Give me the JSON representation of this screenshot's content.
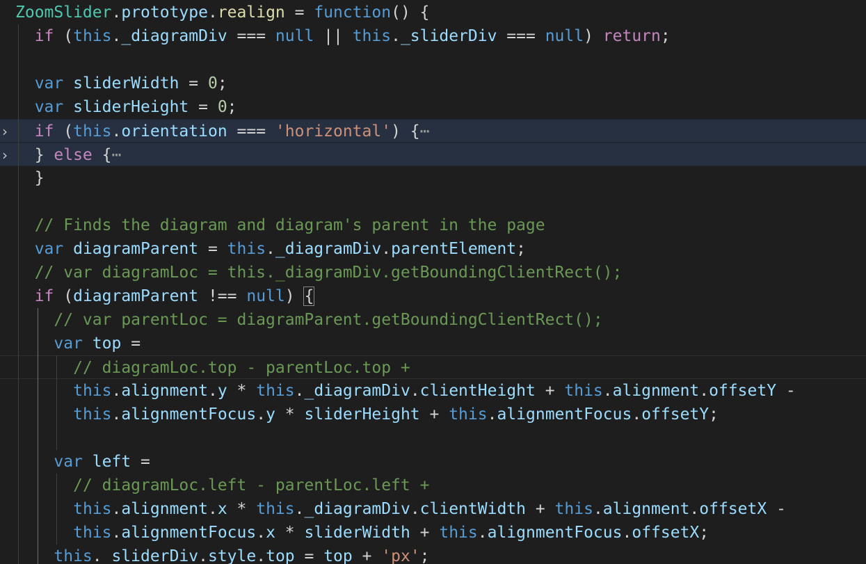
{
  "editor": {
    "language": "javascript",
    "theme_colors": {
      "background": "#1e1e1e",
      "keyword": "#569cd6",
      "control": "#c586c0",
      "function": "#dcdcaa",
      "class": "#4ec9b0",
      "variable": "#9cdcfe",
      "number": "#b5cea8",
      "string": "#ce9178",
      "comment": "#6a9955",
      "folded_line_bg": "#263040"
    },
    "folded_region_icon": "chevron-right-icon",
    "lines": [
      {
        "tokens": [
          [
            "cls",
            "ZoomSlider"
          ],
          [
            "op",
            "."
          ],
          [
            "var",
            "prototype"
          ],
          [
            "op",
            "."
          ],
          [
            "fn",
            "realign"
          ],
          [
            "op",
            " = "
          ],
          [
            "kw",
            "function"
          ],
          [
            "op",
            "() {"
          ]
        ]
      },
      {
        "tokens": [
          [
            "ctl",
            "if"
          ],
          [
            "op",
            " ("
          ],
          [
            "kw",
            "this"
          ],
          [
            "op",
            "."
          ],
          [
            "var",
            "_diagramDiv"
          ],
          [
            "op",
            " === "
          ],
          [
            "kw",
            "null"
          ],
          [
            "op",
            " || "
          ],
          [
            "kw",
            "this"
          ],
          [
            "op",
            "."
          ],
          [
            "var",
            "_sliderDiv"
          ],
          [
            "op",
            " === "
          ],
          [
            "kw",
            "null"
          ],
          [
            "op",
            ") "
          ],
          [
            "ctl",
            "return"
          ],
          [
            "op",
            ";"
          ]
        ]
      },
      {
        "tokens": []
      },
      {
        "tokens": [
          [
            "kw",
            "var"
          ],
          [
            "op",
            " "
          ],
          [
            "var",
            "sliderWidth"
          ],
          [
            "op",
            " = "
          ],
          [
            "num",
            "0"
          ],
          [
            "op",
            ";"
          ]
        ]
      },
      {
        "tokens": [
          [
            "kw",
            "var"
          ],
          [
            "op",
            " "
          ],
          [
            "var",
            "sliderHeight"
          ],
          [
            "op",
            " = "
          ],
          [
            "num",
            "0"
          ],
          [
            "op",
            ";"
          ]
        ]
      },
      {
        "tokens": [
          [
            "ctl",
            "if"
          ],
          [
            "op",
            " ("
          ],
          [
            "kw",
            "this"
          ],
          [
            "op",
            "."
          ],
          [
            "var",
            "orientation"
          ],
          [
            "op",
            " === "
          ],
          [
            "str",
            "'horizontal'"
          ],
          [
            "op",
            ") {"
          ],
          [
            "ellipsis",
            "⋯"
          ]
        ]
      },
      {
        "tokens": [
          [
            "op",
            "} "
          ],
          [
            "ctl",
            "else"
          ],
          [
            "op",
            " {"
          ],
          [
            "ellipsis",
            "⋯"
          ]
        ]
      },
      {
        "tokens": [
          [
            "op",
            "}"
          ]
        ]
      },
      {
        "tokens": []
      },
      {
        "tokens": [
          [
            "cmt",
            "// Finds the diagram and diagram's parent in the page"
          ]
        ]
      },
      {
        "tokens": [
          [
            "kw",
            "var"
          ],
          [
            "op",
            " "
          ],
          [
            "var",
            "diagramParent"
          ],
          [
            "op",
            " = "
          ],
          [
            "kw",
            "this"
          ],
          [
            "op",
            "."
          ],
          [
            "var",
            "_diagramDiv"
          ],
          [
            "op",
            "."
          ],
          [
            "var",
            "parentElement"
          ],
          [
            "op",
            ";"
          ]
        ]
      },
      {
        "tokens": [
          [
            "cmt",
            "// var diagramLoc = this._diagramDiv.getBoundingClientRect();"
          ]
        ]
      },
      {
        "tokens": [
          [
            "ctl",
            "if"
          ],
          [
            "op",
            " ("
          ],
          [
            "var",
            "diagramParent"
          ],
          [
            "op",
            " !== "
          ],
          [
            "kw",
            "null"
          ],
          [
            "op",
            ") "
          ],
          [
            "bracket",
            "{"
          ]
        ]
      },
      {
        "tokens": [
          [
            "cmt",
            "// var parentLoc = diagramParent.getBoundingClientRect();"
          ]
        ]
      },
      {
        "tokens": [
          [
            "kw",
            "var"
          ],
          [
            "op",
            " "
          ],
          [
            "var",
            "top"
          ],
          [
            "op",
            " ="
          ]
        ]
      },
      {
        "tokens": [
          [
            "cmt",
            "// diagramLoc.top - parentLoc.top +"
          ]
        ]
      },
      {
        "tokens": [
          [
            "kw",
            "this"
          ],
          [
            "op",
            "."
          ],
          [
            "var",
            "alignment"
          ],
          [
            "op",
            "."
          ],
          [
            "var",
            "y"
          ],
          [
            "op",
            " * "
          ],
          [
            "kw",
            "this"
          ],
          [
            "op",
            "."
          ],
          [
            "var",
            "_diagramDiv"
          ],
          [
            "op",
            "."
          ],
          [
            "var",
            "clientHeight"
          ],
          [
            "op",
            " + "
          ],
          [
            "kw",
            "this"
          ],
          [
            "op",
            "."
          ],
          [
            "var",
            "alignment"
          ],
          [
            "op",
            "."
          ],
          [
            "var",
            "offsetY"
          ],
          [
            "op",
            " -"
          ]
        ]
      },
      {
        "tokens": [
          [
            "kw",
            "this"
          ],
          [
            "op",
            "."
          ],
          [
            "var",
            "alignmentFocus"
          ],
          [
            "op",
            "."
          ],
          [
            "var",
            "y"
          ],
          [
            "op",
            " * "
          ],
          [
            "var",
            "sliderHeight"
          ],
          [
            "op",
            " + "
          ],
          [
            "kw",
            "this"
          ],
          [
            "op",
            "."
          ],
          [
            "var",
            "alignmentFocus"
          ],
          [
            "op",
            "."
          ],
          [
            "var",
            "offsetY"
          ],
          [
            "op",
            ";"
          ]
        ]
      },
      {
        "tokens": []
      },
      {
        "tokens": [
          [
            "kw",
            "var"
          ],
          [
            "op",
            " "
          ],
          [
            "var",
            "left"
          ],
          [
            "op",
            " ="
          ]
        ]
      },
      {
        "tokens": [
          [
            "cmt",
            "// diagramLoc.left - parentLoc.left +"
          ]
        ]
      },
      {
        "tokens": [
          [
            "kw",
            "this"
          ],
          [
            "op",
            "."
          ],
          [
            "var",
            "alignment"
          ],
          [
            "op",
            "."
          ],
          [
            "var",
            "x"
          ],
          [
            "op",
            " * "
          ],
          [
            "kw",
            "this"
          ],
          [
            "op",
            "."
          ],
          [
            "var",
            "_diagramDiv"
          ],
          [
            "op",
            "."
          ],
          [
            "var",
            "clientWidth"
          ],
          [
            "op",
            " + "
          ],
          [
            "kw",
            "this"
          ],
          [
            "op",
            "."
          ],
          [
            "var",
            "alignment"
          ],
          [
            "op",
            "."
          ],
          [
            "var",
            "offsetX"
          ],
          [
            "op",
            " -"
          ]
        ]
      },
      {
        "tokens": [
          [
            "kw",
            "this"
          ],
          [
            "op",
            "."
          ],
          [
            "var",
            "alignmentFocus"
          ],
          [
            "op",
            "."
          ],
          [
            "var",
            "x"
          ],
          [
            "op",
            " * "
          ],
          [
            "var",
            "sliderWidth"
          ],
          [
            "op",
            " + "
          ],
          [
            "kw",
            "this"
          ],
          [
            "op",
            "."
          ],
          [
            "var",
            "alignmentFocus"
          ],
          [
            "op",
            "."
          ],
          [
            "var",
            "offsetX"
          ],
          [
            "op",
            ";"
          ]
        ]
      },
      {
        "tokens": [
          [
            "kw",
            "this"
          ],
          [
            "op",
            "."
          ],
          [
            "var",
            "_sliderDiv"
          ],
          [
            "op",
            "."
          ],
          [
            "var",
            "style"
          ],
          [
            "op",
            "."
          ],
          [
            "var",
            "top"
          ],
          [
            "op",
            " = "
          ],
          [
            "var",
            "top"
          ],
          [
            "op",
            " + "
          ],
          [
            "str",
            "'px'"
          ],
          [
            "op",
            ";"
          ]
        ]
      }
    ]
  }
}
